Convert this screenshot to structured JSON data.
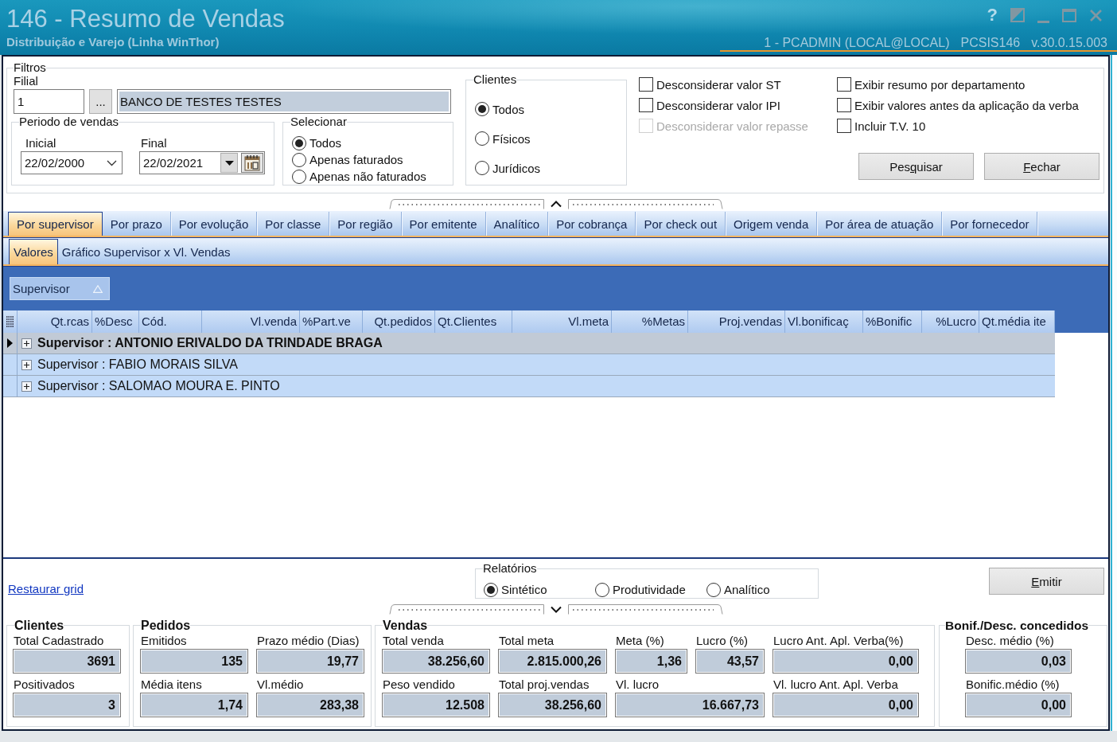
{
  "window": {
    "title": "146 - Resumo de Vendas",
    "subtitle": "Distribuição e Varejo (Linha WinThor)",
    "help": "?",
    "session": "1 - PCADMIN (LOCAL@LOCAL)",
    "program": "PCSIS146",
    "version": "v.30.0.15.003"
  },
  "filters": {
    "title": "Filtros",
    "filial": {
      "label": "Filial",
      "code": "1",
      "browse": "...",
      "name": "BANCO DE TESTES TESTES"
    },
    "period": {
      "title": "Periodo de vendas",
      "start": {
        "label": "Inicial",
        "value": "22/02/2000"
      },
      "end": {
        "label": "Final",
        "value": "22/02/2021"
      }
    },
    "selecionar": {
      "title": "Selecionar",
      "options": [
        {
          "label": "Todos",
          "selected": true
        },
        {
          "label": "Apenas faturados",
          "selected": false
        },
        {
          "label": "Apenas não faturados",
          "selected": false
        }
      ]
    },
    "clientes": {
      "title": "Clientes",
      "options": [
        {
          "label": "Todos",
          "selected": true
        },
        {
          "label": "Físicos",
          "selected": false
        },
        {
          "label": "Jurídicos",
          "selected": false
        }
      ]
    },
    "options_1": [
      {
        "label": "Desconsiderar valor ST",
        "checked": false,
        "disabled": false
      },
      {
        "label": "Desconsiderar valor IPI",
        "checked": false,
        "disabled": false
      },
      {
        "label": "Desconsiderar valor repasse",
        "checked": false,
        "disabled": true
      }
    ],
    "options_2": [
      {
        "label": "Exibir resumo por departamento",
        "checked": false,
        "disabled": false
      },
      {
        "label": "Exibir valores antes da aplicação da verba",
        "checked": false,
        "disabled": false
      },
      {
        "label": "Incluir T.V. 10",
        "checked": false,
        "disabled": false
      }
    ],
    "buttons": [
      {
        "before": "Pes",
        "key": "q",
        "after": "uisar"
      },
      {
        "key": "F",
        "after": "echar"
      }
    ]
  },
  "tabs": [
    {
      "label": "Por supervisor",
      "selected": true
    },
    {
      "label": "Por prazo",
      "selected": false
    },
    {
      "label": "Por evolução",
      "selected": false
    },
    {
      "label": "Por classe",
      "selected": false
    },
    {
      "label": "Por região",
      "selected": false
    },
    {
      "label": "Por emitente",
      "selected": false
    },
    {
      "label": "Analítico",
      "selected": false
    },
    {
      "label": "Por cobrança",
      "selected": false
    },
    {
      "label": "Por check out",
      "selected": false
    },
    {
      "label": "Origem venda",
      "selected": false
    },
    {
      "label": "Por área de atuação",
      "selected": false
    },
    {
      "label": "Por fornecedor",
      "selected": false
    }
  ],
  "subtabs": [
    {
      "label": "Valores",
      "selected": true
    },
    {
      "label": "Gráfico Supervisor x Vl. Vendas",
      "selected": false
    }
  ],
  "grid": {
    "group_by": [
      {
        "label": "Supervisor",
        "ascending": true
      }
    ],
    "columns": [
      "Qt.rcas",
      "%Desc",
      "Cód.",
      "Vl.venda",
      "%Part.ve",
      "Qt.pedidos",
      "Qt.Clientes",
      "Vl.meta",
      "%Metas",
      "Proj.vendas",
      "Vl.bonificaç",
      "%Bonific",
      "%Lucro",
      "Qt.média ite"
    ],
    "rows": [
      {
        "label": "Supervisor : ANTONIO ERIVALDO DA TRINDADE BRAGA",
        "selected": true,
        "expanded": false
      },
      {
        "label": "Supervisor : FABIO MORAIS SILVA",
        "selected": false,
        "expanded": false
      },
      {
        "label": "Supervisor : SALOMAO MOURA E. PINTO",
        "selected": false,
        "expanded": false
      }
    ]
  },
  "restore_link": "Restaurar grid",
  "reports": {
    "title": "Relatórios",
    "options": [
      {
        "label": "Sintético",
        "selected": true
      },
      {
        "label": "Produtividade",
        "selected": false
      },
      {
        "label": "Analítico",
        "selected": false
      }
    ],
    "button": {
      "key": "E",
      "after": "mitir"
    }
  },
  "summary": [
    {
      "title": "Clientes",
      "fields": [
        {
          "label": "Total Cadastrado",
          "value": "3691"
        },
        {
          "label": "Positivados",
          "value": "3"
        }
      ]
    },
    {
      "title": "Pedidos",
      "fields": [
        {
          "label": "Emitidos",
          "value": "135"
        },
        {
          "label": "Prazo médio (Dias)",
          "value": "19,77"
        },
        {
          "label": "Média itens",
          "value": "1,74"
        },
        {
          "label": "Vl.médio",
          "value": "283,38"
        }
      ]
    },
    {
      "title": "Vendas",
      "fields": [
        {
          "label": "Total venda",
          "value": "38.256,60"
        },
        {
          "label": "Total meta",
          "value": "2.815.000,26"
        },
        {
          "label": "Meta (%)",
          "value": "1,36"
        },
        {
          "label": "Lucro (%)",
          "value": "43,57"
        },
        {
          "label": "Lucro Ant. Apl. Verba(%)",
          "value": "0,00"
        },
        {
          "label": "Peso vendido",
          "value": "12.508"
        },
        {
          "label": "Total proj.vendas",
          "value": "38.256,60"
        },
        {
          "label": "Vl. lucro",
          "value": "16.667,73"
        },
        {
          "label": "Vl. lucro Ant. Apl. Verba",
          "value": "0,00"
        }
      ]
    },
    {
      "title": "Bonif./Desc. concedidos",
      "fields": [
        {
          "label": "Desc. médio (%)",
          "value": "0,03"
        },
        {
          "label": "Bonific.médio (%)",
          "value": "0,00"
        }
      ]
    }
  ]
}
